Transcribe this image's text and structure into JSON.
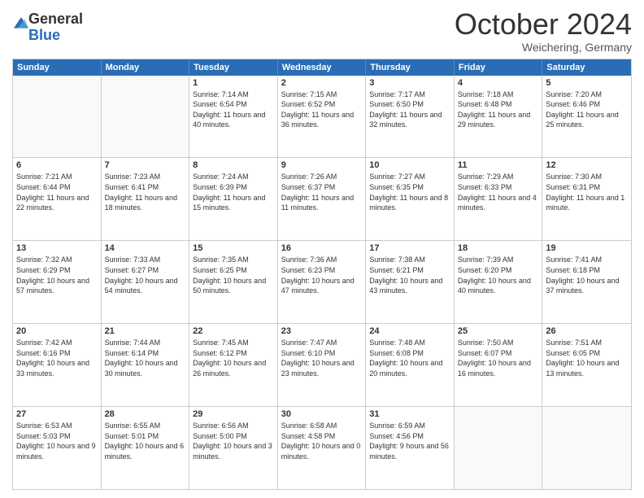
{
  "logo": {
    "general": "General",
    "blue": "Blue"
  },
  "title": "October 2024",
  "location": "Weichering, Germany",
  "header_days": [
    "Sunday",
    "Monday",
    "Tuesday",
    "Wednesday",
    "Thursday",
    "Friday",
    "Saturday"
  ],
  "weeks": [
    [
      {
        "day": "",
        "empty": true
      },
      {
        "day": "",
        "empty": true
      },
      {
        "day": "1",
        "sunrise": "Sunrise: 7:14 AM",
        "sunset": "Sunset: 6:54 PM",
        "daylight": "Daylight: 11 hours and 40 minutes."
      },
      {
        "day": "2",
        "sunrise": "Sunrise: 7:15 AM",
        "sunset": "Sunset: 6:52 PM",
        "daylight": "Daylight: 11 hours and 36 minutes."
      },
      {
        "day": "3",
        "sunrise": "Sunrise: 7:17 AM",
        "sunset": "Sunset: 6:50 PM",
        "daylight": "Daylight: 11 hours and 32 minutes."
      },
      {
        "day": "4",
        "sunrise": "Sunrise: 7:18 AM",
        "sunset": "Sunset: 6:48 PM",
        "daylight": "Daylight: 11 hours and 29 minutes."
      },
      {
        "day": "5",
        "sunrise": "Sunrise: 7:20 AM",
        "sunset": "Sunset: 6:46 PM",
        "daylight": "Daylight: 11 hours and 25 minutes."
      }
    ],
    [
      {
        "day": "6",
        "sunrise": "Sunrise: 7:21 AM",
        "sunset": "Sunset: 6:44 PM",
        "daylight": "Daylight: 11 hours and 22 minutes."
      },
      {
        "day": "7",
        "sunrise": "Sunrise: 7:23 AM",
        "sunset": "Sunset: 6:41 PM",
        "daylight": "Daylight: 11 hours and 18 minutes."
      },
      {
        "day": "8",
        "sunrise": "Sunrise: 7:24 AM",
        "sunset": "Sunset: 6:39 PM",
        "daylight": "Daylight: 11 hours and 15 minutes."
      },
      {
        "day": "9",
        "sunrise": "Sunrise: 7:26 AM",
        "sunset": "Sunset: 6:37 PM",
        "daylight": "Daylight: 11 hours and 11 minutes."
      },
      {
        "day": "10",
        "sunrise": "Sunrise: 7:27 AM",
        "sunset": "Sunset: 6:35 PM",
        "daylight": "Daylight: 11 hours and 8 minutes."
      },
      {
        "day": "11",
        "sunrise": "Sunrise: 7:29 AM",
        "sunset": "Sunset: 6:33 PM",
        "daylight": "Daylight: 11 hours and 4 minutes."
      },
      {
        "day": "12",
        "sunrise": "Sunrise: 7:30 AM",
        "sunset": "Sunset: 6:31 PM",
        "daylight": "Daylight: 11 hours and 1 minute."
      }
    ],
    [
      {
        "day": "13",
        "sunrise": "Sunrise: 7:32 AM",
        "sunset": "Sunset: 6:29 PM",
        "daylight": "Daylight: 10 hours and 57 minutes."
      },
      {
        "day": "14",
        "sunrise": "Sunrise: 7:33 AM",
        "sunset": "Sunset: 6:27 PM",
        "daylight": "Daylight: 10 hours and 54 minutes."
      },
      {
        "day": "15",
        "sunrise": "Sunrise: 7:35 AM",
        "sunset": "Sunset: 6:25 PM",
        "daylight": "Daylight: 10 hours and 50 minutes."
      },
      {
        "day": "16",
        "sunrise": "Sunrise: 7:36 AM",
        "sunset": "Sunset: 6:23 PM",
        "daylight": "Daylight: 10 hours and 47 minutes."
      },
      {
        "day": "17",
        "sunrise": "Sunrise: 7:38 AM",
        "sunset": "Sunset: 6:21 PM",
        "daylight": "Daylight: 10 hours and 43 minutes."
      },
      {
        "day": "18",
        "sunrise": "Sunrise: 7:39 AM",
        "sunset": "Sunset: 6:20 PM",
        "daylight": "Daylight: 10 hours and 40 minutes."
      },
      {
        "day": "19",
        "sunrise": "Sunrise: 7:41 AM",
        "sunset": "Sunset: 6:18 PM",
        "daylight": "Daylight: 10 hours and 37 minutes."
      }
    ],
    [
      {
        "day": "20",
        "sunrise": "Sunrise: 7:42 AM",
        "sunset": "Sunset: 6:16 PM",
        "daylight": "Daylight: 10 hours and 33 minutes."
      },
      {
        "day": "21",
        "sunrise": "Sunrise: 7:44 AM",
        "sunset": "Sunset: 6:14 PM",
        "daylight": "Daylight: 10 hours and 30 minutes."
      },
      {
        "day": "22",
        "sunrise": "Sunrise: 7:45 AM",
        "sunset": "Sunset: 6:12 PM",
        "daylight": "Daylight: 10 hours and 26 minutes."
      },
      {
        "day": "23",
        "sunrise": "Sunrise: 7:47 AM",
        "sunset": "Sunset: 6:10 PM",
        "daylight": "Daylight: 10 hours and 23 minutes."
      },
      {
        "day": "24",
        "sunrise": "Sunrise: 7:48 AM",
        "sunset": "Sunset: 6:08 PM",
        "daylight": "Daylight: 10 hours and 20 minutes."
      },
      {
        "day": "25",
        "sunrise": "Sunrise: 7:50 AM",
        "sunset": "Sunset: 6:07 PM",
        "daylight": "Daylight: 10 hours and 16 minutes."
      },
      {
        "day": "26",
        "sunrise": "Sunrise: 7:51 AM",
        "sunset": "Sunset: 6:05 PM",
        "daylight": "Daylight: 10 hours and 13 minutes."
      }
    ],
    [
      {
        "day": "27",
        "sunrise": "Sunrise: 6:53 AM",
        "sunset": "Sunset: 5:03 PM",
        "daylight": "Daylight: 10 hours and 9 minutes."
      },
      {
        "day": "28",
        "sunrise": "Sunrise: 6:55 AM",
        "sunset": "Sunset: 5:01 PM",
        "daylight": "Daylight: 10 hours and 6 minutes."
      },
      {
        "day": "29",
        "sunrise": "Sunrise: 6:56 AM",
        "sunset": "Sunset: 5:00 PM",
        "daylight": "Daylight: 10 hours and 3 minutes."
      },
      {
        "day": "30",
        "sunrise": "Sunrise: 6:58 AM",
        "sunset": "Sunset: 4:58 PM",
        "daylight": "Daylight: 10 hours and 0 minutes."
      },
      {
        "day": "31",
        "sunrise": "Sunrise: 6:59 AM",
        "sunset": "Sunset: 4:56 PM",
        "daylight": "Daylight: 9 hours and 56 minutes."
      },
      {
        "day": "",
        "empty": true
      },
      {
        "day": "",
        "empty": true
      }
    ]
  ]
}
